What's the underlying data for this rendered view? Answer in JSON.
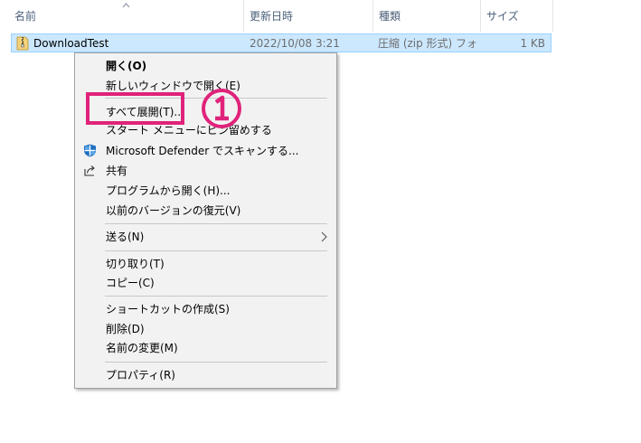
{
  "columns": {
    "name": "名前",
    "modified": "更新日時",
    "type": "種類",
    "size": "サイズ"
  },
  "file": {
    "name": "DownloadTest",
    "modified": "2022/10/08 3:21",
    "type": "圧縮 (zip 形式) フォ...",
    "size": "1 KB",
    "icon": "zip-folder-icon"
  },
  "menu": {
    "open": "開く(O)",
    "open_new_window": "新しいウィンドウで開く(E)",
    "extract_all": "すべて展開(T)...",
    "pin_start": "スタート メニューにピン留めする",
    "defender_scan": "Microsoft Defender でスキャンする...",
    "share": "共有",
    "open_with": "プログラムから開く(H)...",
    "restore_versions": "以前のバージョンの復元(V)",
    "send_to": "送る(N)",
    "cut": "切り取り(T)",
    "copy": "コピー(C)",
    "create_shortcut": "ショートカットの作成(S)",
    "delete": "削除(D)",
    "rename": "名前の変更(M)",
    "properties": "プロパティ(R)"
  },
  "annotation": {
    "step_label": "①",
    "color": "#e0237a"
  },
  "colors": {
    "selection_bg": "#cce8ff",
    "selection_border": "#99d1ff",
    "header_text": "#4c607a",
    "menu_bg": "#f2f2f2"
  }
}
